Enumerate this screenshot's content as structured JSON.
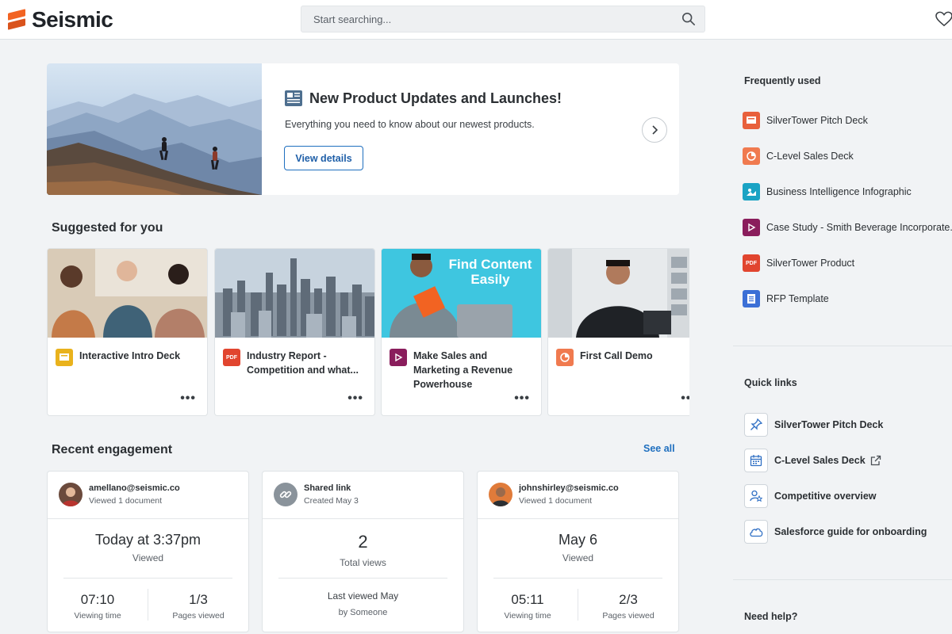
{
  "header": {
    "logo_text": "Seismic",
    "search_placeholder": "Start searching..."
  },
  "hero": {
    "title": "New Product Updates and Launches!",
    "subtitle": "Everything you need to know about our newest products.",
    "button_label": "View details"
  },
  "suggested": {
    "heading": "Suggested for you",
    "cards": [
      {
        "title": "Interactive Intro Deck",
        "icon": "livedoc-icon",
        "icon_color": "#e9b21c",
        "icon_text": ""
      },
      {
        "title": "Industry Report - Competition and what...",
        "icon": "pdf-icon",
        "icon_color": "#e1452f",
        "icon_text": "PDF"
      },
      {
        "title": "Make Sales and Marketing a Revenue Powerhouse",
        "icon": "video-icon",
        "icon_color": "#8a1d5c",
        "icon_text": "",
        "image_text": "Find Content Easily"
      },
      {
        "title": "First Call Demo",
        "icon": "presentation-icon",
        "icon_color": "#f07a4f",
        "icon_text": ""
      }
    ]
  },
  "engagement": {
    "heading": "Recent engagement",
    "see_all": "See all",
    "cards": [
      {
        "who": "amellano@seismic.co",
        "what": "Viewed 1 document",
        "big": "Today at 3:37pm",
        "label": "Viewed",
        "stat1_value": "07:10",
        "stat1_label": "Viewing time",
        "stat2_value": "1/3",
        "stat2_label": "Pages viewed"
      },
      {
        "who": "Shared link",
        "what": "Created May 3",
        "big": "2",
        "label": "Total views",
        "footer1": "Last viewed May",
        "footer2": "by Someone"
      },
      {
        "who": "johnshirley@seismic.co",
        "what": "Viewed 1 document",
        "big": "May 6",
        "label": "Viewed",
        "stat1_value": "05:11",
        "stat1_label": "Viewing time",
        "stat2_value": "2/3",
        "stat2_label": "Pages viewed"
      }
    ]
  },
  "sidebar": {
    "frequently_used_heading": "Frequently used",
    "frequently_used": [
      {
        "label": "SilverTower Pitch Deck",
        "icon": "livedoc-icon",
        "icon_color": "#e8603c"
      },
      {
        "label": "C-Level Sales Deck",
        "icon": "presentation-icon",
        "icon_color": "#f07a4f"
      },
      {
        "label": "Business Intelligence Infographic",
        "icon": "image-icon",
        "icon_color": "#1aa3c4"
      },
      {
        "label": "Case Study - Smith Beverage Incorporate...",
        "icon": "video-icon",
        "icon_color": "#8a1d5c"
      },
      {
        "label": "SilverTower Product",
        "icon": "pdf-icon",
        "icon_color": "#e1452f",
        "icon_text": "PDF"
      },
      {
        "label": "RFP Template",
        "icon": "word-livedoc-icon",
        "icon_color": "#3b6fd6"
      }
    ],
    "quick_links_heading": "Quick links",
    "quick_links": [
      {
        "label": "SilverTower Pitch Deck",
        "icon": "pin-icon"
      },
      {
        "label": "C-Level Sales Deck",
        "icon": "calendar-icon",
        "external": true
      },
      {
        "label": "Competitive overview",
        "icon": "user-star-icon"
      },
      {
        "label": "Salesforce guide for onboarding",
        "icon": "cloud-icon"
      }
    ],
    "need_help_heading": "Need help?"
  }
}
